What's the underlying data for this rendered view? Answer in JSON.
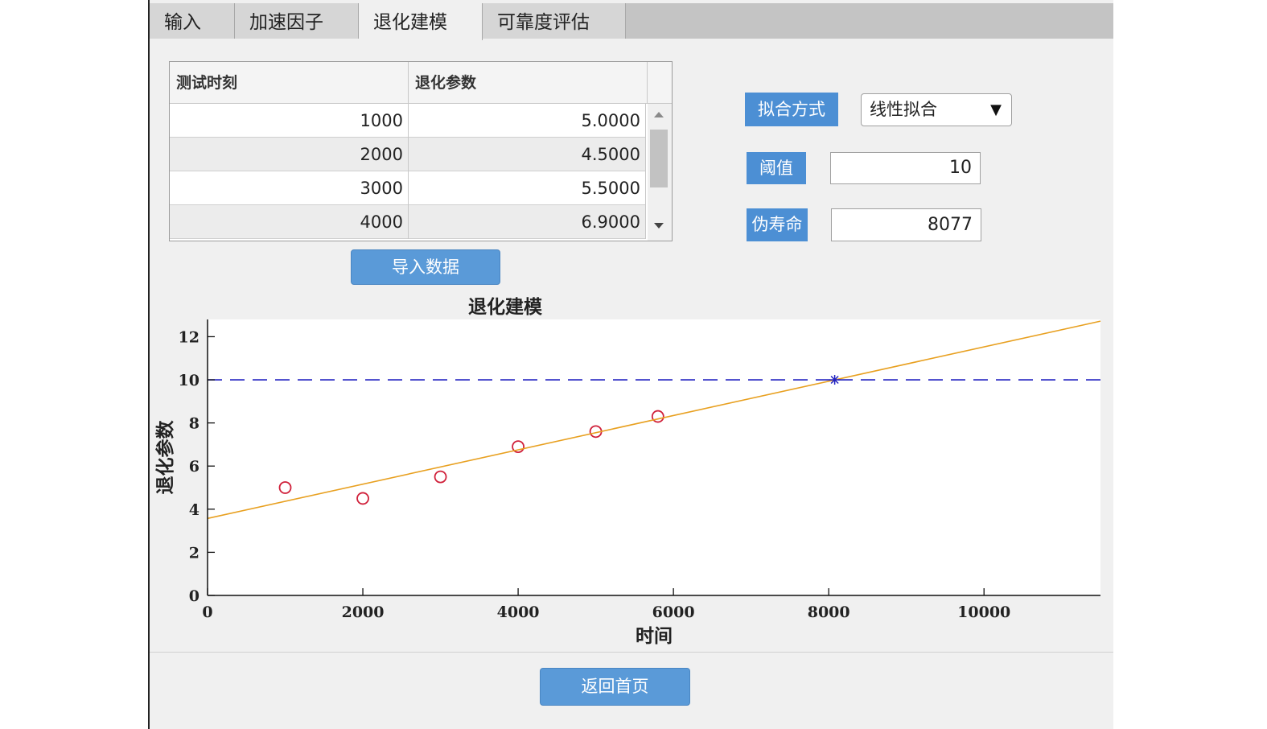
{
  "tabs": [
    {
      "label": "输入",
      "active": false
    },
    {
      "label": "加速因子",
      "active": false
    },
    {
      "label": "退化建模",
      "active": true
    },
    {
      "label": "可靠度评估",
      "active": false
    }
  ],
  "table": {
    "columns": [
      "测试时刻",
      "退化参数"
    ],
    "rows": [
      {
        "time": "1000",
        "param": "5.0000"
      },
      {
        "time": "2000",
        "param": "4.5000"
      },
      {
        "time": "3000",
        "param": "5.5000"
      },
      {
        "time": "4000",
        "param": "6.9000"
      }
    ]
  },
  "import_button": "导入数据",
  "fit": {
    "label": "拟合方式",
    "selected": "线性拟合",
    "arrow": "▼"
  },
  "threshold": {
    "label": "阈值",
    "value": "10"
  },
  "pseudo_life": {
    "label": "伪寿命",
    "value": "8077"
  },
  "back_button": "返回首页",
  "colors": {
    "accent": "#4c8fd4",
    "fit_line": "#e8a020",
    "threshold_line": "#2020c0",
    "marker": "#d0203a"
  },
  "chart_data": {
    "type": "scatter",
    "title": "退化建模",
    "xlabel": "时间",
    "ylabel": "退化参数",
    "xlim": [
      0,
      11500
    ],
    "ylim": [
      0,
      12.8
    ],
    "xticks": [
      0,
      2000,
      4000,
      6000,
      8000,
      10000
    ],
    "yticks": [
      0,
      2,
      4,
      6,
      8,
      10,
      12
    ],
    "series": [
      {
        "type": "scatter",
        "marker": "circle",
        "x": [
          1000,
          2000,
          3000,
          4000,
          5000,
          5800
        ],
        "y": [
          5.0,
          4.5,
          5.5,
          6.9,
          7.6,
          8.3
        ]
      },
      {
        "type": "line",
        "style": "solid",
        "x": [
          0,
          11500
        ],
        "y": [
          3.57,
          12.72
        ]
      },
      {
        "type": "line",
        "style": "dashed",
        "x": [
          0,
          11500
        ],
        "y": [
          10,
          10
        ]
      },
      {
        "type": "point",
        "marker": "asterisk",
        "x": [
          8077
        ],
        "y": [
          10
        ]
      }
    ],
    "grid": false
  }
}
